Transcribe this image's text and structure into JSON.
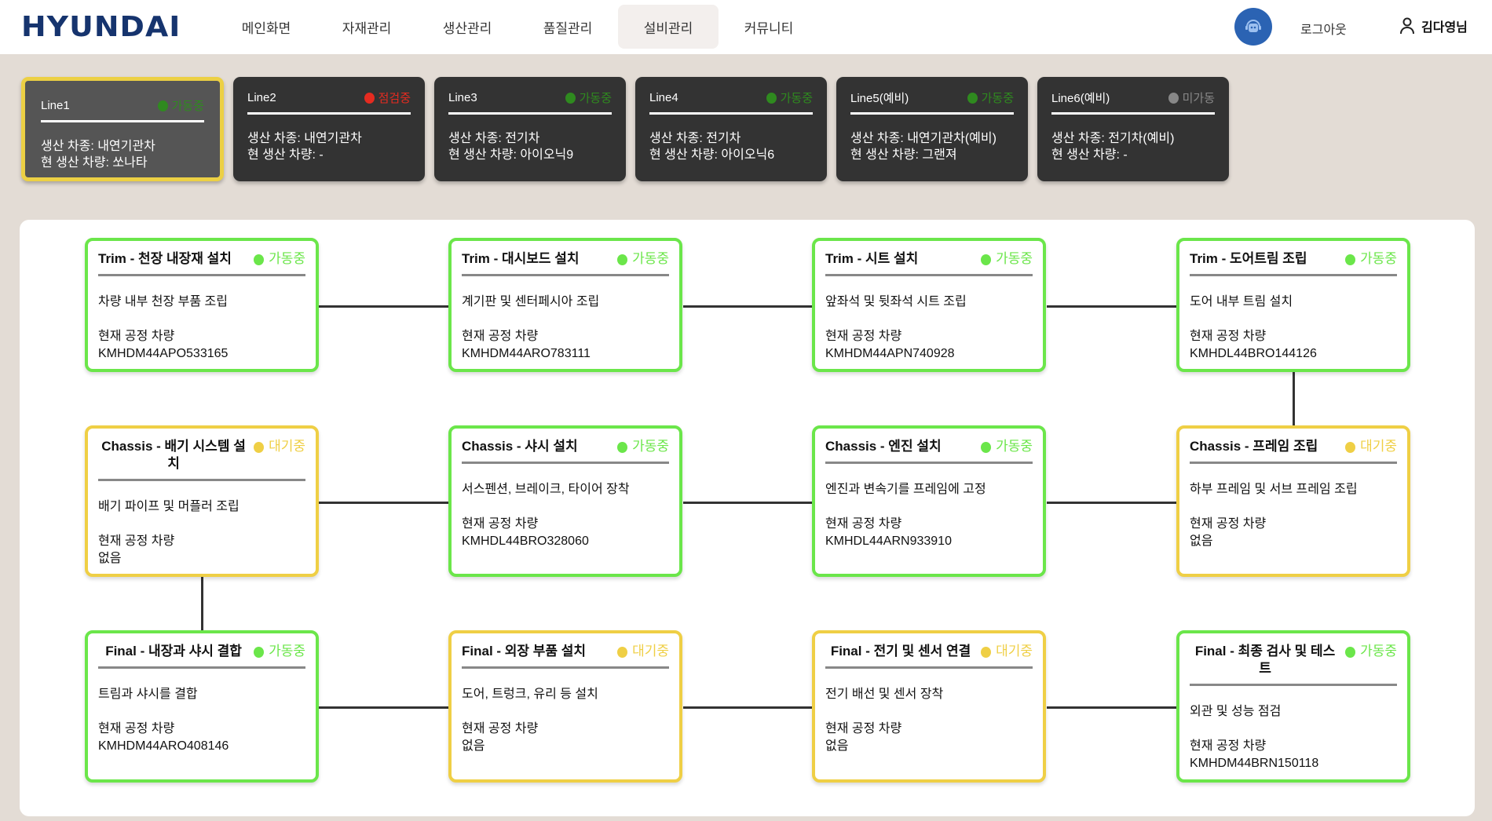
{
  "header": {
    "logo": "HYUNDAI",
    "nav": [
      {
        "label": "메인화면"
      },
      {
        "label": "자재관리"
      },
      {
        "label": "생산관리"
      },
      {
        "label": "품질관리"
      },
      {
        "label": "설비관리"
      },
      {
        "label": "커뮤니티"
      }
    ],
    "active_nav": "설비관리",
    "logout": "로그아웃",
    "user": "김다영님"
  },
  "colors": {
    "running": "#6be64a",
    "waiting": "#efcf45",
    "inspect": "#e52b20",
    "idle": "#888888",
    "line_running": "#2f8a1f"
  },
  "lines": [
    {
      "name": "Line1",
      "status": "가동중",
      "type": "생산 차종: 내연기관차",
      "vehicle": "현 생산 차량: 쏘나타"
    },
    {
      "name": "Line2",
      "status": "점검중",
      "type": "생산 차종: 내연기관차",
      "vehicle": "현 생산 차량: -"
    },
    {
      "name": "Line3",
      "status": "가동중",
      "type": "생산 차종: 전기차",
      "vehicle": "현 생산 차량: 아이오닉9"
    },
    {
      "name": "Line4",
      "status": "가동중",
      "type": "생산 차종: 전기차",
      "vehicle": "현 생산 차량: 아이오닉6"
    },
    {
      "name": "Line5(예비)",
      "status": "가동중",
      "type": "생산 차종: 내연기관차(예비)",
      "vehicle": "현 생산 차량: 그랜져"
    },
    {
      "name": "Line6(예비)",
      "status": "미가동",
      "type": "생산 차종: 전기차(예비)",
      "vehicle": "현 생산 차량: -"
    }
  ],
  "processes": [
    {
      "title": "Trim - 천장 내장재 설치",
      "status": "가동중",
      "desc": "차량 내부 천장 부품 조립",
      "cur_label": "현재 공정 차량",
      "cur": "KMHDM44APO533165"
    },
    {
      "title": "Trim - 대시보드 설치",
      "status": "가동중",
      "desc": "계기판 및 센터페시아 조립",
      "cur_label": "현재 공정 차량",
      "cur": "KMHDM44ARO783111"
    },
    {
      "title": "Trim - 시트 설치",
      "status": "가동중",
      "desc": "앞좌석 및 뒷좌석 시트 조립",
      "cur_label": "현재 공정 차량",
      "cur": "KMHDM44APN740928"
    },
    {
      "title": "Trim - 도어트림 조립",
      "status": "가동중",
      "desc": "도어 내부 트림 설치",
      "cur_label": "현재 공정 차량",
      "cur": "KMHDL44BRO144126"
    },
    {
      "title": "Chassis - 배기 시스템 설치",
      "status": "대기중",
      "desc": "배기 파이프 및 머플러 조립",
      "cur_label": "현재 공정 차량",
      "cur": "없음"
    },
    {
      "title": "Chassis - 샤시 설치",
      "status": "가동중",
      "desc": "서스펜션, 브레이크, 타이어 장착",
      "cur_label": "현재 공정 차량",
      "cur": "KMHDL44BRO328060"
    },
    {
      "title": "Chassis - 엔진 설치",
      "status": "가동중",
      "desc": "엔진과 변속기를 프레임에 고정",
      "cur_label": "현재 공정 차량",
      "cur": "KMHDL44ARN933910"
    },
    {
      "title": "Chassis - 프레임 조립",
      "status": "대기중",
      "desc": "하부 프레임 및 서브 프레임 조립",
      "cur_label": "현재 공정 차량",
      "cur": "없음"
    },
    {
      "title": "Final - 내장과 샤시 결합",
      "status": "가동중",
      "desc": "트림과 샤시를 결합",
      "cur_label": "현재 공정 차량",
      "cur": "KMHDM44ARO408146"
    },
    {
      "title": "Final - 외장 부품 설치",
      "status": "대기중",
      "desc": "도어, 트렁크, 유리 등 설치",
      "cur_label": "현재 공정 차량",
      "cur": "없음"
    },
    {
      "title": "Final - 전기 및 센서 연결",
      "status": "대기중",
      "desc": "전기 배선 및 센서 장착",
      "cur_label": "현재 공정 차량",
      "cur": "없음"
    },
    {
      "title": "Final - 최종 검사 및 테스트",
      "status": "가동중",
      "desc": "외관 및 성능 점검",
      "cur_label": "현재 공정 차량",
      "cur": "KMHDM44BRN150118"
    }
  ]
}
